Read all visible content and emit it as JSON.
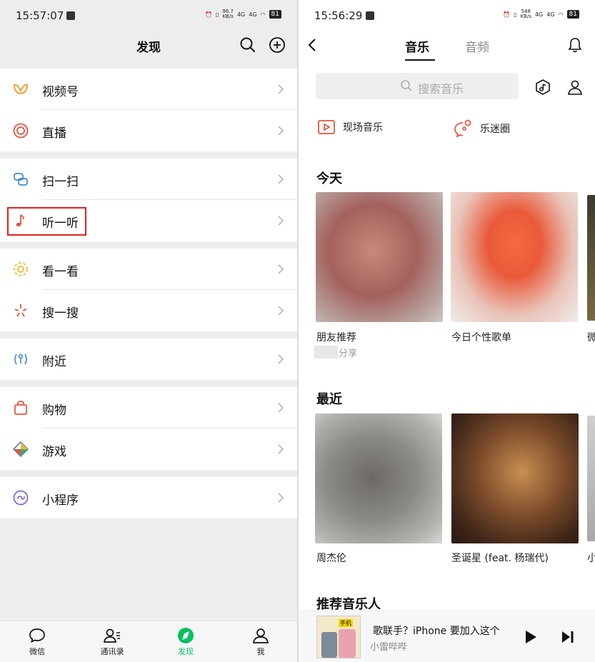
{
  "left": {
    "status": {
      "time": "15:57:07",
      "speed_top": "96.7",
      "speed_unit": "KB/s",
      "net1": "4G",
      "net2": "4G",
      "battery": "81"
    },
    "header": {
      "title": "发现"
    },
    "menu": {
      "g1": [
        {
          "label": "视频号"
        },
        {
          "label": "直播"
        }
      ],
      "g2": [
        {
          "label": "扫一扫"
        },
        {
          "label": "听一听"
        }
      ],
      "g3": [
        {
          "label": "看一看"
        },
        {
          "label": "搜一搜"
        }
      ],
      "g4": [
        {
          "label": "附近"
        }
      ],
      "g5": [
        {
          "label": "购物"
        },
        {
          "label": "游戏"
        }
      ],
      "g6": [
        {
          "label": "小程序"
        }
      ]
    },
    "tabs": [
      {
        "label": "微信"
      },
      {
        "label": "通讯录"
      },
      {
        "label": "发现"
      },
      {
        "label": "我"
      }
    ]
  },
  "right": {
    "status": {
      "time": "15:56:29",
      "speed_top": "548",
      "speed_unit": "KB/s",
      "net1": "4G",
      "net2": "4G",
      "battery": "81"
    },
    "tabs": {
      "music": "音乐",
      "audio": "音频"
    },
    "search": {
      "placeholder": "搜索音乐"
    },
    "shortcuts": {
      "live": "现场音乐",
      "circle": "乐迷圈"
    },
    "today": {
      "title": "今天",
      "cards": [
        {
          "label": "朋友推荐",
          "sub": "分享"
        },
        {
          "label": "今日个性歌单"
        },
        {
          "label": "微"
        }
      ]
    },
    "recent": {
      "title": "最近",
      "cards": [
        {
          "label": "周杰伦"
        },
        {
          "label": "圣诞星 (feat. 杨瑞代)"
        },
        {
          "label": "小"
        }
      ]
    },
    "artists": {
      "title": "推荐音乐人"
    },
    "player": {
      "title": "歌联手？iPhone 要加入这个",
      "artist": "小雷哔哔",
      "cover_text": "手机"
    }
  },
  "colors": {
    "accent_green": "#07c160",
    "highlight_red": "#e0221b"
  }
}
